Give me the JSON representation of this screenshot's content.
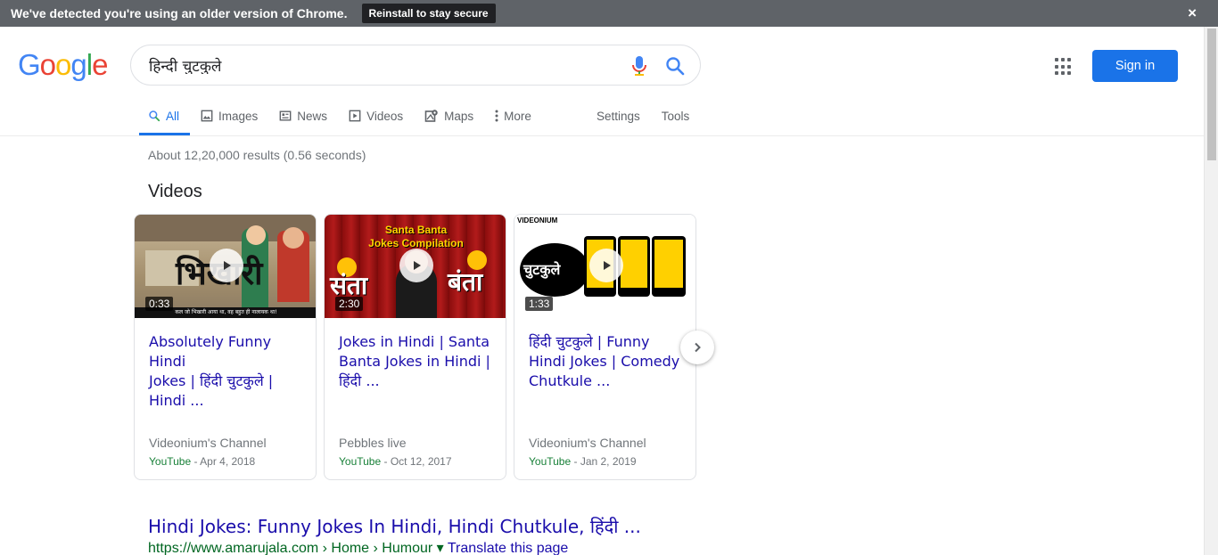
{
  "banner": {
    "message": "We've detected you're using an older version of Chrome.",
    "button": "Reinstall to stay secure",
    "close": "×"
  },
  "header": {
    "logo_letters": [
      "G",
      "o",
      "o",
      "g",
      "l",
      "e"
    ],
    "logo_colors": [
      "#4285f4",
      "#ea4335",
      "#fbbc05",
      "#4285f4",
      "#34a853",
      "#ea4335"
    ],
    "query": "हिन्दी चुटकुले",
    "sign_in": "Sign in"
  },
  "tabs": {
    "items": [
      {
        "label": "All",
        "icon": "search-icon"
      },
      {
        "label": "Images",
        "icon": "image-icon"
      },
      {
        "label": "News",
        "icon": "news-icon"
      },
      {
        "label": "Videos",
        "icon": "video-icon"
      },
      {
        "label": "Maps",
        "icon": "map-icon"
      },
      {
        "label": "More",
        "icon": "more-vert-icon"
      }
    ],
    "settings": "Settings",
    "tools": "Tools"
  },
  "stats": "About 12,20,000 results (0.56 seconds)",
  "videos": {
    "heading": "Videos",
    "cards": [
      {
        "duration": "0:33",
        "title_lines": [
          "Absolutely Funny Hindi",
          "Jokes | हिंदी चुटकुले |",
          "Hindi ..."
        ],
        "channel": "Videonium's Channel",
        "source": "YouTube",
        "date": " - Apr 4, 2018",
        "thumb_text": "भिखारी",
        "thumb_caption": "कल जो भिखारी आया था, वह बहुत ही नालायक था!"
      },
      {
        "duration": "2:30",
        "title_lines": [
          "Jokes in Hindi | Santa",
          "Banta Jokes in Hindi |",
          "हिंदी ..."
        ],
        "channel": "Pebbles live",
        "source": "YouTube",
        "date": " - Oct 12, 2017",
        "thumb_text_1": "Santa Banta",
        "thumb_text_2": "Jokes Compilation",
        "thumb_left": "संता",
        "thumb_right": "बंता"
      },
      {
        "duration": "1:33",
        "title_lines": [
          "हिंदी चुटकुले | Funny",
          "Hindi Jokes | Comedy",
          "Chutkule ..."
        ],
        "channel": "Videonium's Channel",
        "source": "YouTube",
        "date": " - Jan 2, 2019",
        "thumb_brand": "VIDEONIUM",
        "thumb_text": "चुटकुले"
      }
    ]
  },
  "result": {
    "title": "Hindi Jokes: Funny Jokes In Hindi, Hindi Chutkule, हिंदी ...",
    "url": "https://www.amarujala.com › Home › Humour ",
    "dropdown": "▾",
    "translate": " Translate this page"
  }
}
